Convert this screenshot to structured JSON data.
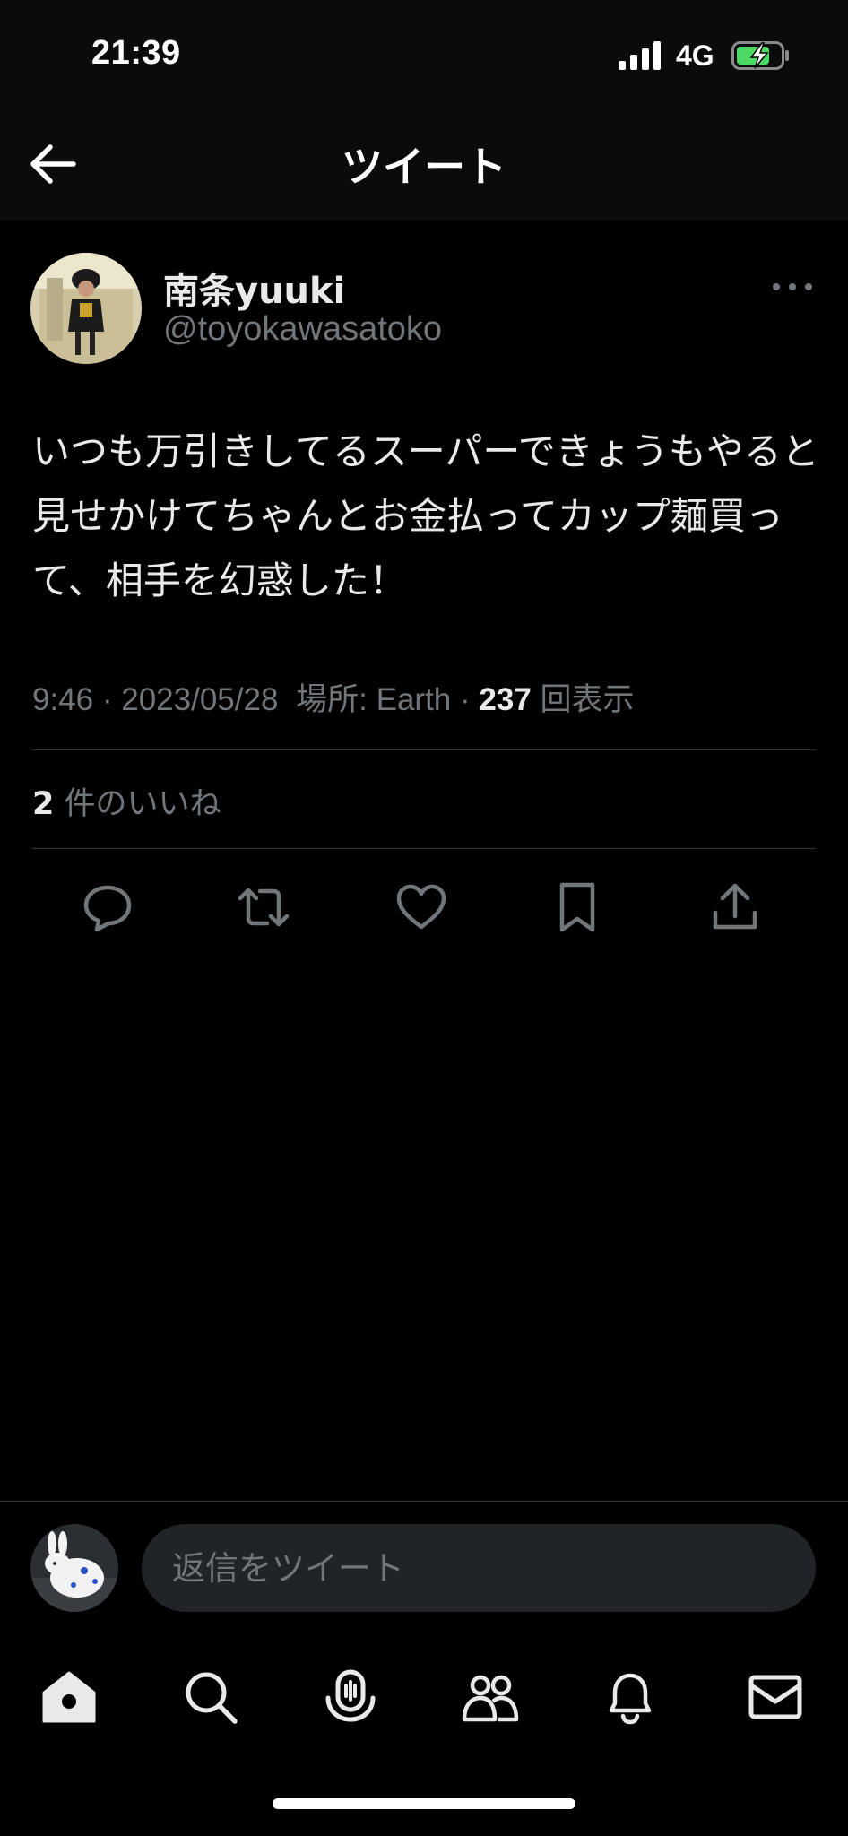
{
  "status_bar": {
    "time": "21:39",
    "network": "4G"
  },
  "header": {
    "title": "ツイート"
  },
  "tweet": {
    "display_name": "南条yuuki",
    "handle": "@toyokawasatoko",
    "text": "いつも万引きしてるスーパーできょうもやると見せかけてちゃんとお金払ってカップ麺買って、相手を幻惑した！",
    "time": "9:46",
    "date": "2023/05/28",
    "location_label": "場所: Earth",
    "views_count": "237",
    "views_label": "回表示",
    "likes_count": "2",
    "likes_label": "件のいいね"
  },
  "reply": {
    "placeholder": "返信をツイート"
  },
  "actions": [
    "reply-icon",
    "retweet-icon",
    "heart-icon",
    "bookmark-icon",
    "share-icon"
  ],
  "nav": [
    "home-icon",
    "search-icon",
    "spaces-icon",
    "communities-icon",
    "notifications-icon",
    "messages-icon"
  ],
  "colors": {
    "background": "#000000",
    "header": "#0b0b0b",
    "text": "#e7e9ea",
    "secondary": "#71767b",
    "divider": "#2f3336",
    "input": "#202327",
    "battery": "#4cd964"
  }
}
